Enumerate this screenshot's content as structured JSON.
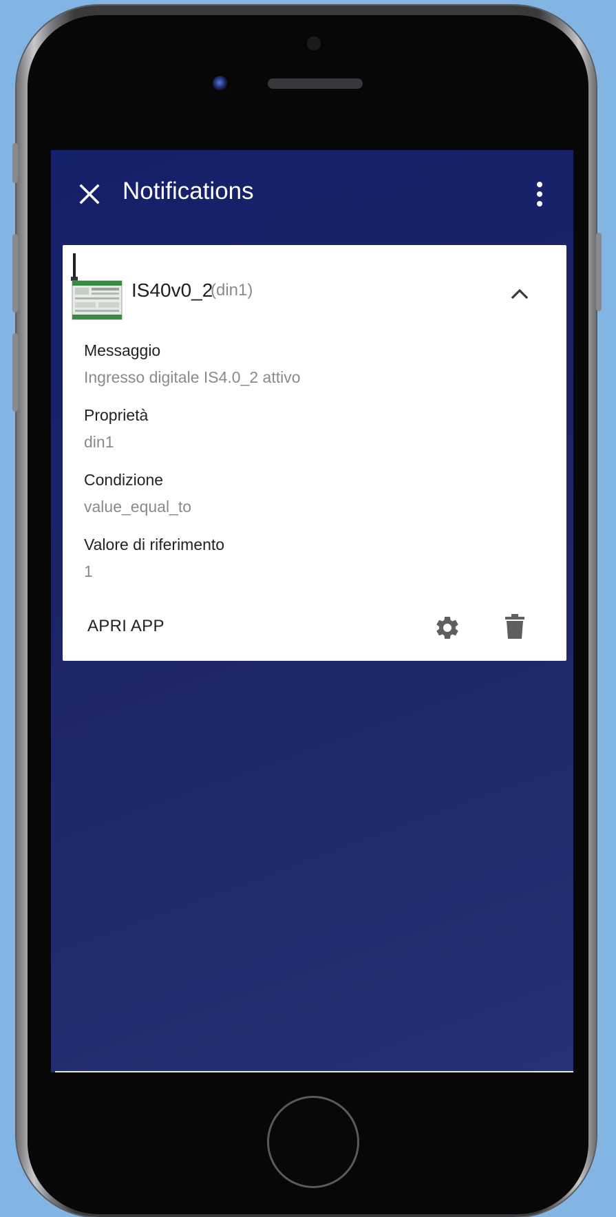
{
  "app_bar": {
    "title": "Notifications",
    "close_icon": "close-icon",
    "menu_icon": "more-vert-icon"
  },
  "notification": {
    "device_name": "IS40v0_2",
    "property_suffix": "(din1)",
    "fields": [
      {
        "label": "Messaggio",
        "value": "Ingresso digitale IS4.0_2 attivo"
      },
      {
        "label": "Proprietà",
        "value": "din1"
      },
      {
        "label": "Condizione",
        "value": "value_equal_to"
      },
      {
        "label": "Valore di riferimento",
        "value": "1"
      }
    ],
    "open_app_label": "APRI APP",
    "settings_icon": "gear-icon",
    "delete_icon": "trash-icon",
    "collapse_icon": "chevron-up-icon"
  },
  "colors": {
    "background": "#82b5e3",
    "screen_top": "#15206a",
    "screen_bottom": "#263176",
    "card": "#ffffff",
    "icon_grey": "#5f5f5f"
  }
}
